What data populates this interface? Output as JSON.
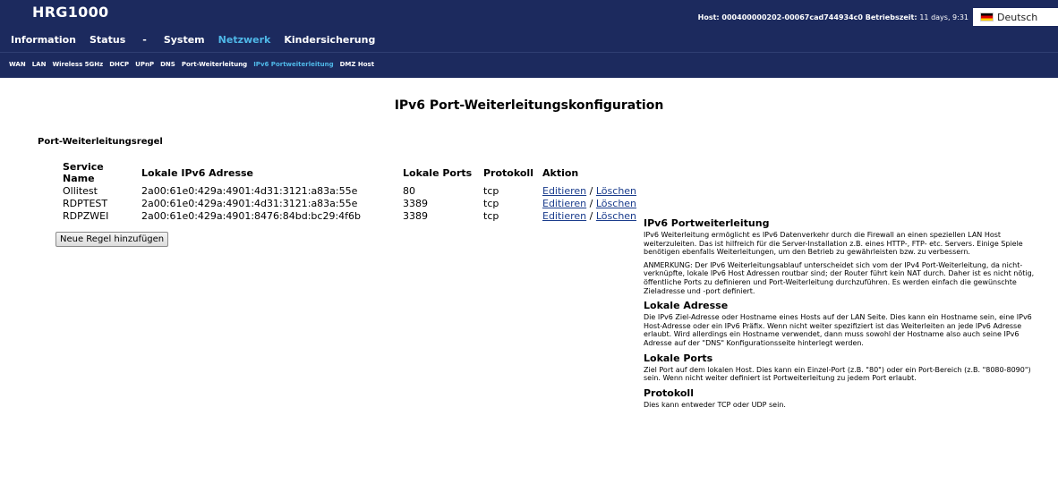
{
  "app": {
    "title": "HRG1000",
    "host_label": "Host:",
    "host_value": "000400000202-00067cad744934c0",
    "uptime_label": "Betriebszeit:",
    "uptime_value": "11 days, 9:31",
    "language": "Deutsch"
  },
  "mainnav": [
    {
      "label": "Information",
      "active": false
    },
    {
      "label": "Status",
      "active": false
    },
    {
      "label": "-",
      "active": false
    },
    {
      "label": "System",
      "active": false
    },
    {
      "label": "Netzwerk",
      "active": true
    },
    {
      "label": "Kindersicherung",
      "active": false
    }
  ],
  "subnav": [
    {
      "label": "WAN"
    },
    {
      "label": "LAN"
    },
    {
      "label": "Wireless 5GHz"
    },
    {
      "label": "DHCP"
    },
    {
      "label": "UPnP"
    },
    {
      "label": "DNS"
    },
    {
      "label": "Port-Weiterleitung"
    },
    {
      "label": "IPv6 Portweiterleitung",
      "active": true
    },
    {
      "label": "DMZ Host"
    }
  ],
  "page": {
    "title": "IPv6 Port-Weiterleitungskonfiguration",
    "section_title": "Port-Weiterleitungsregel"
  },
  "table": {
    "headers": [
      "Service Name",
      "Lokale IPv6 Adresse",
      "Lokale Ports",
      "Protokoll",
      "Aktion"
    ],
    "rows": [
      {
        "service": "Ollitest",
        "address": "2a00:61e0:429a:4901:4d31:3121:a83a:55e",
        "ports": "80",
        "protocol": "tcp"
      },
      {
        "service": "RDPTEST",
        "address": "2a00:61e0:429a:4901:4d31:3121:a83a:55e",
        "ports": "3389",
        "protocol": "tcp"
      },
      {
        "service": "RDPZWEI",
        "address": "2a00:61e0:429a:4901:8476:84bd:bc29:4f6b",
        "ports": "3389",
        "protocol": "tcp"
      }
    ],
    "edit_label": "Editieren",
    "separator": "/",
    "delete_label": "Löschen"
  },
  "add_button": "Neue Regel hinzufügen",
  "help": {
    "s1_title": "IPv6 Portweiterleitung",
    "s1_p1": "IPv6 Weiterleitung ermöglicht es IPv6 Datenverkehr durch die Firewall an einen speziellen LAN Host weiterzuleiten. Das ist hilfreich für die Server-Installation z.B. eines HTTP-, FTP- etc. Servers. Einige Spiele benötigen ebenfalls Weiterleitungen, um den Betrieb zu gewährleisten bzw. zu verbessern.",
    "s1_p2": "ANMERKUNG: Der IPv6 Weiterleitungsablauf unterscheidet sich vom der IPv4 Port-Weiterleitung, da nicht-verknüpfte, lokale IPv6 Host Adressen routbar sind; der Router führt kein NAT durch. Daher ist es nicht nötig, öffentliche Ports zu definieren und Port-Weiterleitung durchzuführen. Es werden einfach die gewünschte Zieladresse und -port definiert.",
    "s2_title": "Lokale Adresse",
    "s2_p1": "Die IPv6 Ziel-Adresse oder Hostname eines Hosts auf der LAN Seite. Dies kann ein Hostname sein, eine IPv6 Host-Adresse oder ein IPv6 Präfix. Wenn nicht weiter spezifiziert ist das Weiterleiten an jede IPv6 Adresse erlaubt. Wird allerdings ein Hostname verwendet, dann muss sowohl der Hostname also auch seine IPv6 Adresse auf der \"DNS\" Konfigurationsseite hinterlegt werden.",
    "s3_title": "Lokale Ports",
    "s3_p1": "Ziel Port auf dem lokalen Host. Dies kann ein Einzel-Port (z.B. \"80\") oder ein Port-Bereich (z.B. \"8080-8090\") sein. Wenn nicht weiter definiert ist Portweiterleitung zu jedem Port erlaubt.",
    "s4_title": "Protokoll",
    "s4_p1": "Dies kann entweder TCP oder UDP sein."
  }
}
